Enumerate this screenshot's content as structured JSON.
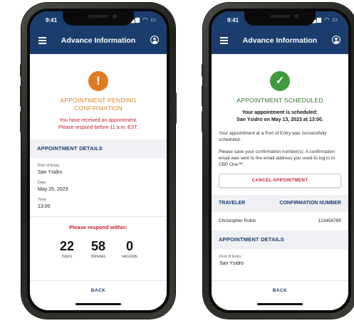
{
  "colors": {
    "header": "#1b3d6e",
    "pending": "#e07b22",
    "scheduled": "#3e9a3c",
    "alert": "#c31f2a"
  },
  "left": {
    "status_time": "9:41",
    "header_title": "Advance Information",
    "status_icon": "exclamation-icon",
    "status_glyph": "!",
    "headline_line1": "APPOINTMENT PENDING",
    "headline_line2": "CONFIRMATION",
    "alert_line1": "You have received an appointment.",
    "alert_line2": "Please respond before 11 a.m. EST.",
    "details_heading": "APPOINTMENT DETAILS",
    "fields": [
      {
        "label": "Port of Entry",
        "value": "San Ysidro"
      },
      {
        "label": "Date",
        "value": "May 25, 2023"
      },
      {
        "label": "Time",
        "value": "13:00"
      }
    ],
    "respond_title": "Please respond within:",
    "countdown": [
      {
        "value": "22",
        "unit": "hours"
      },
      {
        "value": "58",
        "unit": "minutes"
      },
      {
        "value": "0",
        "unit": "seconds"
      }
    ],
    "back_label": "BACK"
  },
  "right": {
    "status_time": "9:41",
    "header_title": "Advance Information",
    "status_icon": "checkmark-icon",
    "status_glyph": "✓",
    "headline": "APPOINTMENT SCHEDULED",
    "confirm_line1": "Your appointment is scheduled:",
    "confirm_line2": "San Ysidro on May 13, 2023 at 13:00.",
    "para1": "Your appointment at a Port of Entry was successfully scheduled.",
    "para2": "Please save your confirmation number(s). A confirmation email was sent to the email address you used to log in to CBP One™.",
    "cancel_label": "CANCEL APPOINTMENT",
    "col_traveler": "TRAVELER",
    "col_confirmation": "CONFIRMATION NUMBER",
    "traveler_name": "Christopher Robin",
    "confirmation_number": "123456789",
    "details_heading": "APPOINTMENT DETAILS",
    "port_label": "Port of Entry",
    "port_value": "San Ysidro",
    "back_label": "BACK"
  }
}
